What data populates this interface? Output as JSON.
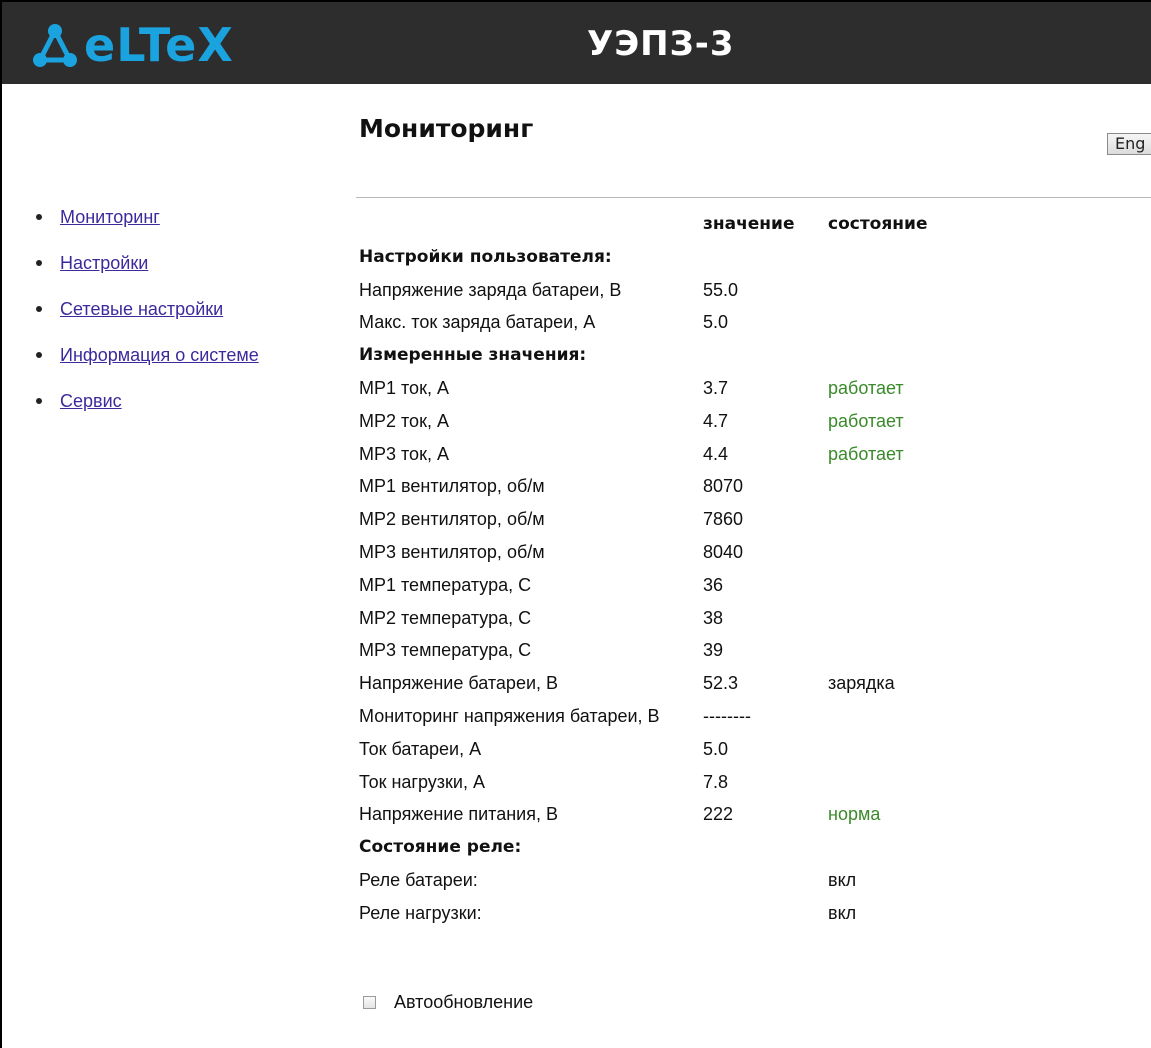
{
  "header": {
    "logo_text": "eLTeX",
    "product_title": "УЭПЗ-3",
    "brand_color": "#1aa3df",
    "background_color": "#2d2d2d"
  },
  "language_button": "Eng",
  "page_title": "Мониторинг",
  "sidebar": {
    "items": [
      {
        "label": "Мониторинг"
      },
      {
        "label": "Настройки"
      },
      {
        "label": "Сетевые настройки"
      },
      {
        "label": "Информация о системе"
      },
      {
        "label": "Сервис"
      }
    ]
  },
  "table": {
    "col_value": "значение",
    "col_state": "состояние",
    "rows": [
      {
        "type": "section",
        "label": "Настройки пользователя:"
      },
      {
        "label": "Напряжение заряда батареи, В",
        "value": "55.0",
        "state": ""
      },
      {
        "label": "Макс. ток заряда батареи, А",
        "value": "5.0",
        "state": ""
      },
      {
        "type": "section",
        "label": "Измеренные значения:"
      },
      {
        "label": "МР1 ток, А",
        "value": "3.7",
        "state": "работает",
        "state_ok": true
      },
      {
        "label": "МР2 ток, А",
        "value": "4.7",
        "state": "работает",
        "state_ok": true
      },
      {
        "label": "МР3 ток, А",
        "value": "4.4",
        "state": "работает",
        "state_ok": true
      },
      {
        "label": "МР1 вентилятор, об/м",
        "value": "8070",
        "state": ""
      },
      {
        "label": "МР2 вентилятор, об/м",
        "value": "7860",
        "state": ""
      },
      {
        "label": "МР3 вентилятор, об/м",
        "value": "8040",
        "state": ""
      },
      {
        "label": "МР1 температура, С",
        "value": "36",
        "state": ""
      },
      {
        "label": "МР2 температура, С",
        "value": "38",
        "state": ""
      },
      {
        "label": "МР3 температура, С",
        "value": "39",
        "state": ""
      },
      {
        "label": "Напряжение батареи, В",
        "value": "52.3",
        "state": "зарядка"
      },
      {
        "label": "Мониторинг напряжения батареи, В",
        "value": "--------",
        "state": ""
      },
      {
        "label": "Ток батареи, А",
        "value": "5.0",
        "state": ""
      },
      {
        "label": "Ток нагрузки, А",
        "value": "7.8",
        "state": ""
      },
      {
        "label": "Напряжение питания, В",
        "value": "222",
        "state": "норма",
        "state_ok": true
      },
      {
        "type": "section",
        "label": "Состояние реле:"
      },
      {
        "label": "Реле батареи:",
        "value": "",
        "state": "вкл"
      },
      {
        "label": "Реле нагрузки:",
        "value": "",
        "state": "вкл"
      }
    ]
  },
  "autoupdate": {
    "label": "Автообновление",
    "checked": false
  },
  "colors": {
    "link": "#3b2a9c",
    "status_ok": "#3a8a2a"
  }
}
